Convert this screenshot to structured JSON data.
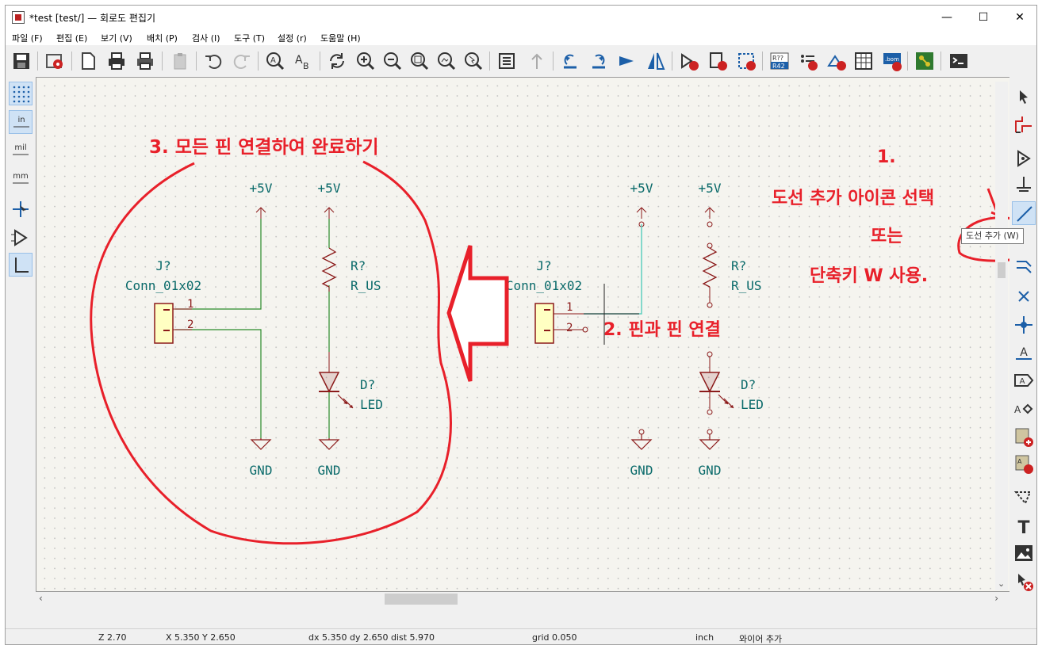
{
  "window": {
    "title": "*test [test/] — 회로도 편집기",
    "minimize": "—",
    "maximize": "☐",
    "close": "✕"
  },
  "menu": [
    "파일 (F)",
    "편집 (E)",
    "보기 (V)",
    "배치 (P)",
    "검사 (I)",
    "도구 (T)",
    "설정 (r)",
    "도움말 (H)"
  ],
  "left_toolbar": {
    "units_in": "in",
    "units_mil": "mil",
    "units_mm": "mm"
  },
  "tooltip": "도선 추가  (W)",
  "schematic": {
    "left_circuit": {
      "pwr1": "+5V",
      "pwr2": "+5V",
      "conn_ref": "J?",
      "conn_value": "Conn_01x02",
      "pin1": "1",
      "pin2": "2",
      "res_ref": "R?",
      "res_value": "R_US",
      "led_ref": "D?",
      "led_value": "LED",
      "gnd1": "GND",
      "gnd2": "GND"
    },
    "right_circuit": {
      "pwr1": "+5V",
      "pwr2": "+5V",
      "conn_ref": "J?",
      "conn_value": "Conn_01x02",
      "pin1": "1",
      "pin2": "2",
      "res_ref": "R?",
      "res_value": "R_US",
      "led_ref": "D?",
      "led_value": "LED",
      "gnd1": "GND",
      "gnd2": "GND"
    }
  },
  "annotations": {
    "step3": "3. 모든 핀 연결하여 완료하기",
    "step2": "2. 핀과 핀 연결",
    "step1_num": "1.",
    "step1_line1": "도선 추가 아이콘 선택",
    "step1_line2": "또는",
    "step1_line3": "단축키 W 사용."
  },
  "status": {
    "zoom": "Z 2.70",
    "xy": "X 5.350  Y 2.650",
    "delta": "dx 5.350  dy 2.650  dist 5.970",
    "grid": "grid 0.050",
    "units": "inch",
    "mode": "와이어 추가"
  },
  "colors": {
    "wire": "#2a8a2a",
    "component": "#8b1a1a",
    "label": "#0a6a6a",
    "annotation": "#e8202a",
    "canvas": "#f5f4ef"
  }
}
